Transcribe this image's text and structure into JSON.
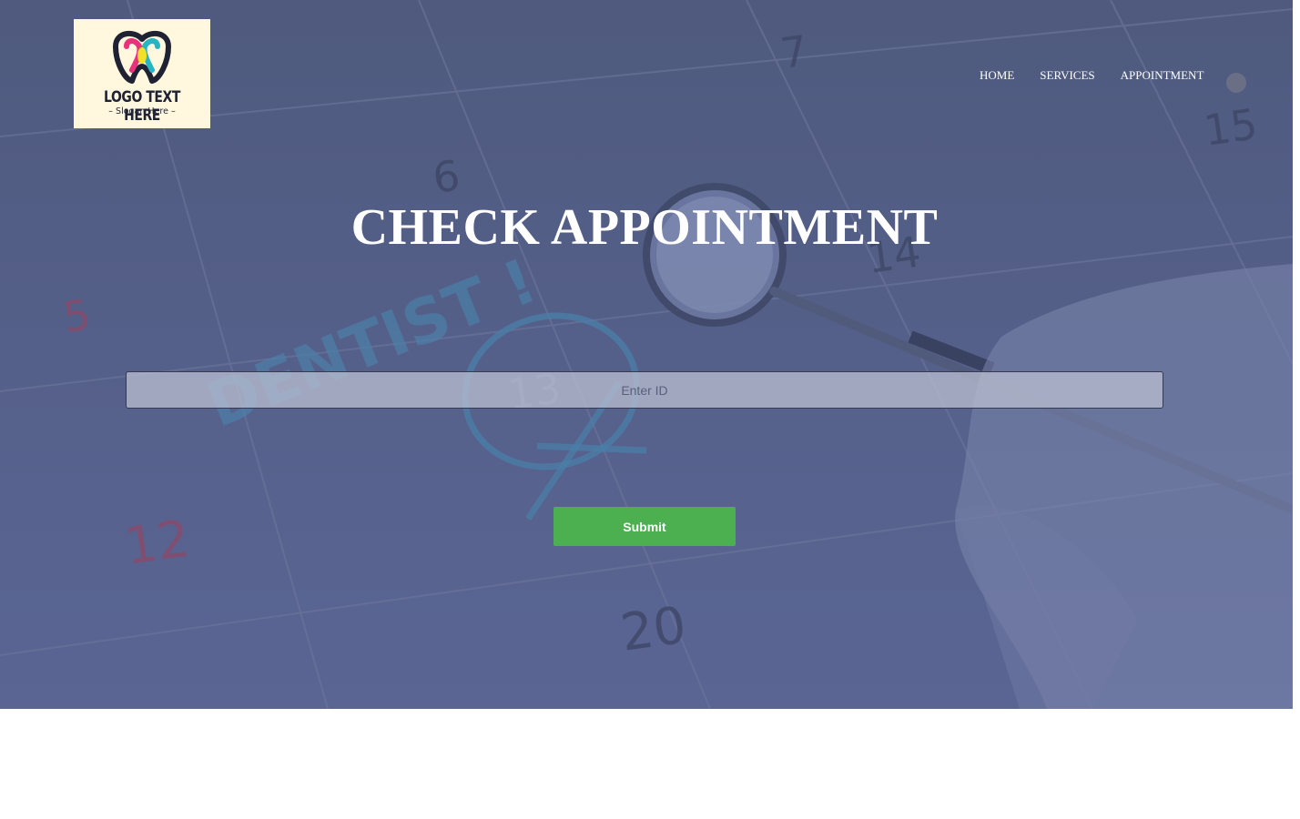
{
  "logo": {
    "title": "LOGO TEXT HERE",
    "slogan": "Slogan Here"
  },
  "nav": {
    "items": [
      {
        "label": "HOME"
      },
      {
        "label": "SERVICES"
      },
      {
        "label": "APPOINTMENT"
      }
    ]
  },
  "page": {
    "title": "CHECK APPOINTMENT"
  },
  "form": {
    "id_placeholder": "Enter ID",
    "id_value": "",
    "submit_label": "Submit"
  },
  "background": {
    "calendar_numbers": [
      "7",
      "6",
      "5",
      "14",
      "15",
      "13",
      "12",
      "20"
    ],
    "handwritten_text": "DENTIST !"
  },
  "colors": {
    "overlay": "#56618c",
    "submit": "#4caf50",
    "logo_bg": "#fff8df"
  }
}
